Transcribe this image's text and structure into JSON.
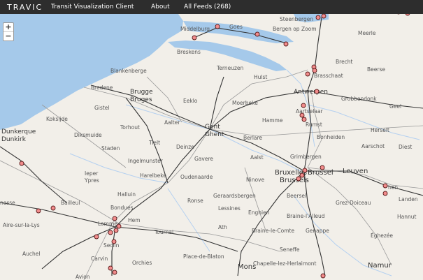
{
  "header": {
    "brand": "TRAVIC",
    "subtitle": "Transit Visualization Client",
    "nav_about": "About",
    "nav_feeds": "All Feeds (268)"
  },
  "zoom": {
    "in_label": "+",
    "out_label": "−"
  },
  "colors": {
    "sea": "#a5c9ea",
    "land": "#f2efe9",
    "rail": "#333333",
    "road": "#9a9a9a",
    "water": "#b4d0f0",
    "stop_fill": "#f28c8c",
    "stop_stroke": "#5a1a1a"
  },
  "places": [
    {
      "id": "steenbergen",
      "text": "Steenbergen"
    },
    {
      "id": "middelburg",
      "text": "Middelburg"
    },
    {
      "id": "goes",
      "text": "Goes"
    },
    {
      "id": "bergen",
      "text": "Bergen op Zoom"
    },
    {
      "id": "meerle",
      "text": "Meerle"
    },
    {
      "id": "breskens",
      "text": "Breskens"
    },
    {
      "id": "brecht",
      "text": "Brecht"
    },
    {
      "id": "blankenberge",
      "text": "Blankenberge"
    },
    {
      "id": "terneuzen",
      "text": "Terneuzen"
    },
    {
      "id": "hulst",
      "text": "Hulst"
    },
    {
      "id": "brasschaat",
      "text": "Brasschaat"
    },
    {
      "id": "beerse",
      "text": "Beerse"
    },
    {
      "id": "bredene",
      "text": "Bredene"
    },
    {
      "id": "brugge",
      "text": "Brugge"
    },
    {
      "id": "bruges",
      "text": "Bruges"
    },
    {
      "id": "antwerpen",
      "text": "Antwerpen"
    },
    {
      "id": "grobbendonk",
      "text": "Grobbendonk"
    },
    {
      "id": "gistel",
      "text": "Gistel"
    },
    {
      "id": "eeklo",
      "text": "Eeklo"
    },
    {
      "id": "moerbeke",
      "text": "Moerbeke"
    },
    {
      "id": "aartselaar",
      "text": "Aartselaar"
    },
    {
      "id": "geel",
      "text": "Geel"
    },
    {
      "id": "koksijde",
      "text": "Koksijde"
    },
    {
      "id": "hamme",
      "text": "Hamme"
    },
    {
      "id": "rumst",
      "text": "Rumst"
    },
    {
      "id": "dunkerque",
      "text": "Dunkerque"
    },
    {
      "id": "dunkirk",
      "text": "Dunkirk"
    },
    {
      "id": "diksmuide",
      "text": "Diksmuide"
    },
    {
      "id": "torhout",
      "text": "Torhout"
    },
    {
      "id": "aalter",
      "text": "Aalter"
    },
    {
      "id": "gent",
      "text": "Gent"
    },
    {
      "id": "ghent",
      "text": "Ghent"
    },
    {
      "id": "berlare",
      "text": "Berlare"
    },
    {
      "id": "bonheiden",
      "text": "Bonheiden"
    },
    {
      "id": "herselt",
      "text": "Herselt"
    },
    {
      "id": "tielt",
      "text": "Tielt"
    },
    {
      "id": "deinze",
      "text": "Deinze"
    },
    {
      "id": "staden",
      "text": "Staden"
    },
    {
      "id": "aarschot",
      "text": "Aarschot"
    },
    {
      "id": "diest",
      "text": "Diest"
    },
    {
      "id": "ingelmunster",
      "text": "Ingelmunster"
    },
    {
      "id": "gavere",
      "text": "Gavere"
    },
    {
      "id": "aalst",
      "text": "Aalst"
    },
    {
      "id": "grimbergen",
      "text": "Grimbergen"
    },
    {
      "id": "ieper",
      "text": "Ieper"
    },
    {
      "id": "ypres",
      "text": "Ypres"
    },
    {
      "id": "harelbeke",
      "text": "Harelbeke"
    },
    {
      "id": "oudenaarde",
      "text": "Oudenaarde"
    },
    {
      "id": "ninove",
      "text": "Ninove"
    },
    {
      "id": "bruxelles",
      "text": "Bruxelles"
    },
    {
      "id": "brussel",
      "text": "Brussel"
    },
    {
      "id": "brussels",
      "text": "Brussels"
    },
    {
      "id": "leuven",
      "text": "Leuven"
    },
    {
      "id": "halluin",
      "text": "Halluin"
    },
    {
      "id": "geraardsbergen",
      "text": "Geraardsbergen"
    },
    {
      "id": "beersel",
      "text": "Beersel"
    },
    {
      "id": "hen",
      "text": "hen"
    },
    {
      "id": "landen",
      "text": "Landen"
    },
    {
      "id": "nesse",
      "text": "nesse"
    },
    {
      "id": "bailleul",
      "text": "Bailleul"
    },
    {
      "id": "ronse",
      "text": "Ronse"
    },
    {
      "id": "grezdoiceau",
      "text": "Grez-Doiceau"
    },
    {
      "id": "bondues",
      "text": "Bondues"
    },
    {
      "id": "lessines",
      "text": "Lessines"
    },
    {
      "id": "enghien",
      "text": "Enghien"
    },
    {
      "id": "brainelalleud",
      "text": "Braine-l'Alleud"
    },
    {
      "id": "hannut",
      "text": "Hannut"
    },
    {
      "id": "airesurlalys",
      "text": "Aire-sur-la-Lys"
    },
    {
      "id": "lomme",
      "text": "Lomme"
    },
    {
      "id": "hem",
      "text": "Hem"
    },
    {
      "id": "tournai",
      "text": "Tournai"
    },
    {
      "id": "ath",
      "text": "Ath"
    },
    {
      "id": "brainelecomte",
      "text": "Braine-le-Comte"
    },
    {
      "id": "genappe",
      "text": "Genappe"
    },
    {
      "id": "eghezee",
      "text": "Éghezée"
    },
    {
      "id": "seclin",
      "text": "Seclin"
    },
    {
      "id": "seneffe",
      "text": "Seneffe"
    },
    {
      "id": "auchel",
      "text": "Auchel"
    },
    {
      "id": "carvin",
      "text": "Carvin"
    },
    {
      "id": "orchies",
      "text": "Orchies"
    },
    {
      "id": "placedebbaton",
      "text": "Place-de-Blaton"
    },
    {
      "id": "chapelle",
      "text": "Chapelle-lez-Herlaimont"
    },
    {
      "id": "namur",
      "text": "Namur"
    },
    {
      "id": "mons",
      "text": "Mons"
    },
    {
      "id": "avion",
      "text": "Avion"
    }
  ]
}
